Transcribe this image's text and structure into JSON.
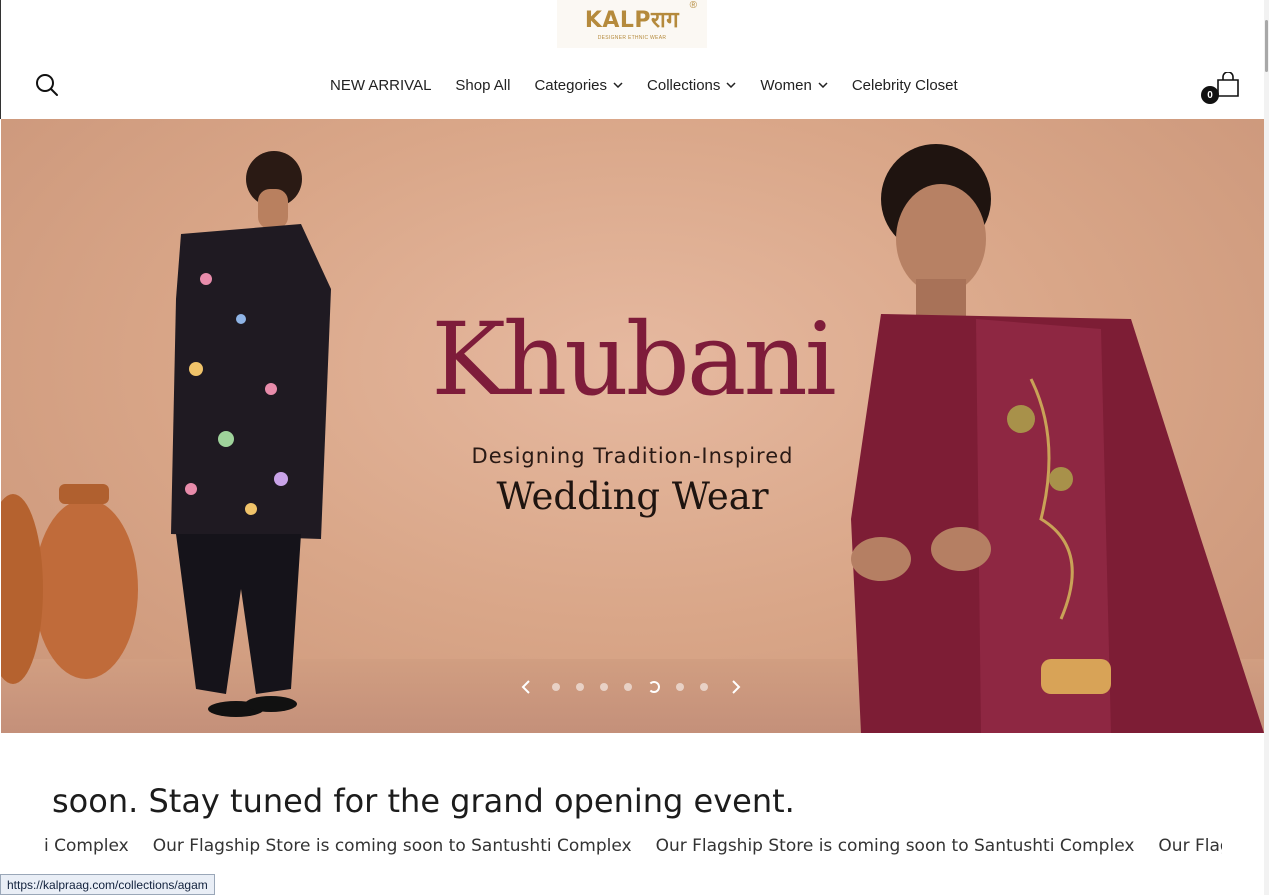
{
  "header": {
    "logo_text": "KALPराग",
    "logo_reg": "®",
    "logo_sub": "DESIGNER ETHNIC WEAR",
    "nav": [
      {
        "label": "NEW ARRIVAL",
        "dropdown": false
      },
      {
        "label": "Shop All",
        "dropdown": false
      },
      {
        "label": "Categories",
        "dropdown": true
      },
      {
        "label": "Collections",
        "dropdown": true
      },
      {
        "label": "Women",
        "dropdown": true
      },
      {
        "label": "Celebrity Closet",
        "dropdown": false
      }
    ],
    "cart_count": "0"
  },
  "hero": {
    "title": "Khubani",
    "subtitle": "Designing Tradition-Inspired",
    "tagline": "Wedding Wear",
    "slides_total": 7,
    "active_slide": 5,
    "accent_color": "#7e1c3a"
  },
  "announcement": {
    "headline": "soon. Stay tuned for the grand opening event.",
    "marquee": [
      "i Complex",
      "Our Flagship Store is coming soon to Santushti Complex",
      "Our Flagship Store is coming soon to Santushti Complex",
      "Our Flagship Store is com"
    ]
  },
  "status_bar": {
    "url": "https://kalpraag.com/collections/agam"
  }
}
